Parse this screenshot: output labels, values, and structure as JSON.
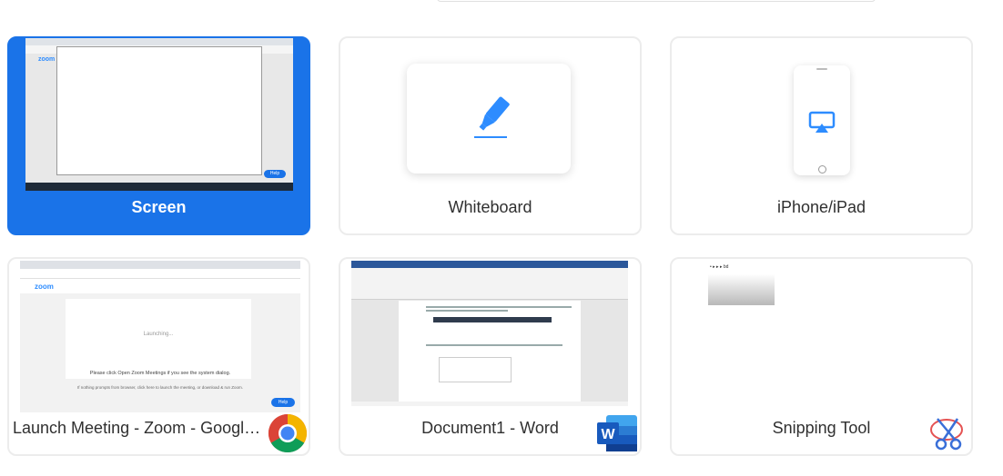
{
  "tiles": [
    {
      "label": "Screen",
      "selected": true
    },
    {
      "label": "Whiteboard",
      "selected": false
    },
    {
      "label": "iPhone/iPad",
      "selected": false
    },
    {
      "label": "Launch Meeting - Zoom - Google...",
      "app_icon": "chrome-icon",
      "selected": false
    },
    {
      "label": "Document1 - Word",
      "app_icon": "word-icon",
      "selected": false
    },
    {
      "label": "Snipping Tool",
      "app_icon": "snipping-tool-icon",
      "selected": false
    }
  ],
  "screen_thumb": {
    "zoom_logo": "zoom",
    "help": "Help"
  },
  "launch_thumb": {
    "logo": "zoom",
    "launching": "Launching...",
    "instruction": "Please click Open Zoom Meetings if you see the system dialog.",
    "hint": "If nothing prompts from browser, click here to launch the meeting, or download & run Zoom.",
    "help": "Help"
  },
  "snip_thumb": {
    "text": "• ▸ ▸ ▸ bd"
  },
  "colors": {
    "selected": "#1a73e8",
    "accent_blue": "#2d8cff",
    "word_blue": "#2b579a"
  }
}
